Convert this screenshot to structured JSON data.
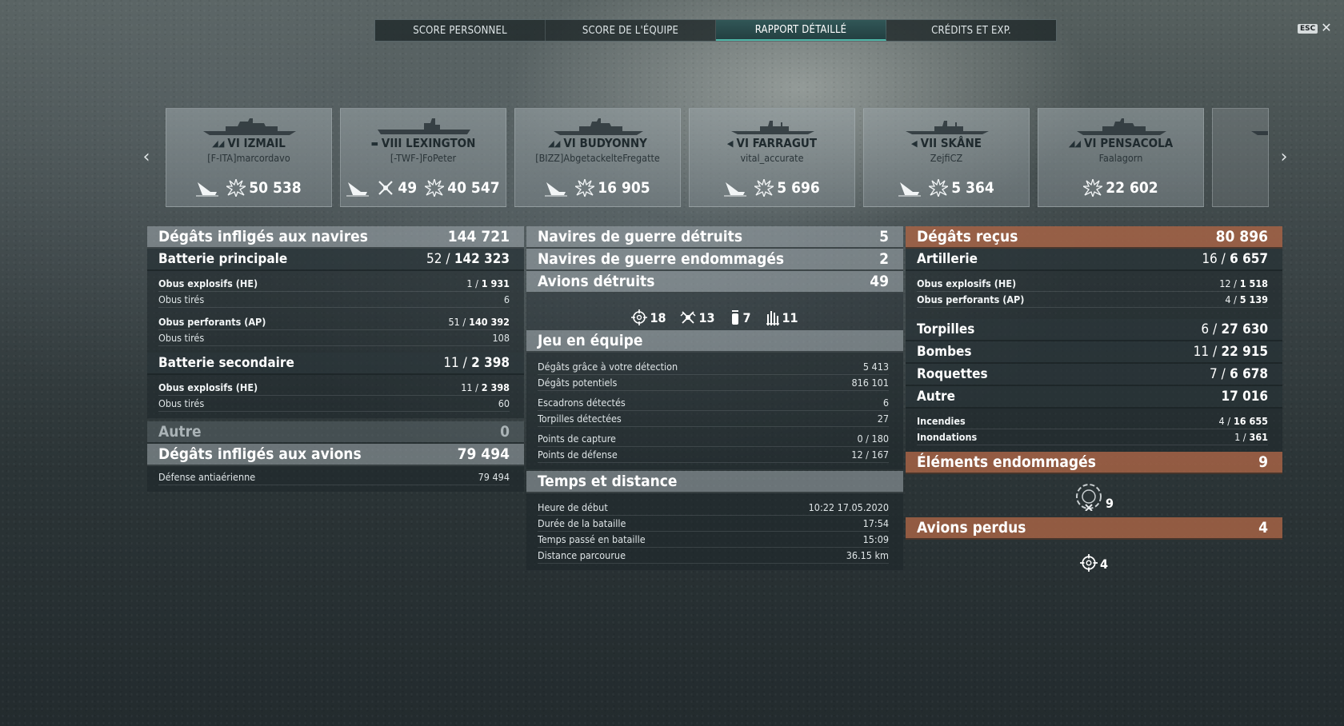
{
  "tabs": [
    {
      "label": "SCORE PERSONNEL"
    },
    {
      "label": "SCORE DE L'ÉQUIPE"
    },
    {
      "label": "RAPPORT DÉTAILLÉ",
      "active": true
    },
    {
      "label": "CRÉDITS ET EXP."
    }
  ],
  "esc": {
    "key": "ESC",
    "close": "✕"
  },
  "carousel": {
    "prev": "‹",
    "next": "›",
    "ships": [
      {
        "tier_name": "VI IZMAIL",
        "class_icon": "battleship-icon",
        "player": "[F-ITA]marcordavo",
        "planes": null,
        "damage": "50 538"
      },
      {
        "tier_name": "VIII LEXINGTON",
        "class_icon": "carrier-icon",
        "player": "[-TWF-]FoPeter",
        "planes": "49",
        "damage": "40 547"
      },
      {
        "tier_name": "VI BUDYONNY",
        "class_icon": "cruiser-icon",
        "player": "[BIZZ]AbgetackelteFregatte",
        "planes": null,
        "damage": "16 905"
      },
      {
        "tier_name": "VI FARRAGUT",
        "class_icon": "destroyer-icon",
        "player": "vital_accurate",
        "planes": null,
        "damage": "5 696"
      },
      {
        "tier_name": "VII SKÅNE",
        "class_icon": "destroyer-icon",
        "player": "ZejfiCZ",
        "planes": null,
        "damage": "5 364"
      },
      {
        "tier_name": "VI PENSACOLA",
        "class_icon": "cruiser-icon",
        "player": "Faalagorn",
        "planes": null,
        "damage": "22 602"
      }
    ]
  },
  "left": {
    "ships_damage": {
      "label": "Dégâts infligés aux navires",
      "value": "144 721"
    },
    "main_battery": {
      "label": "Batterie principale",
      "hits": "52 /",
      "value": "142 323"
    },
    "main_items": [
      {
        "label": "Obus explosifs (HE)",
        "hits": "1 /",
        "value": "1 931",
        "bold": true
      },
      {
        "label": "Obus tirés",
        "hits": "",
        "value": "6",
        "bold": false
      },
      {
        "label": "Obus perforants (AP)",
        "hits": "51 /",
        "value": "140 392",
        "bold": true
      },
      {
        "label": "Obus tirés",
        "hits": "",
        "value": "108",
        "bold": false
      }
    ],
    "secondary_battery": {
      "label": "Batterie secondaire",
      "hits": "11 /",
      "value": "2 398"
    },
    "secondary_items": [
      {
        "label": "Obus explosifs (HE)",
        "hits": "11 /",
        "value": "2 398",
        "bold": true
      },
      {
        "label": "Obus tirés",
        "hits": "",
        "value": "60",
        "bold": false
      }
    ],
    "other": {
      "label": "Autre",
      "value": "0"
    },
    "planes_damage": {
      "label": "Dégâts infligés aux avions",
      "value": "79 494"
    },
    "planes_items": [
      {
        "label": "Défense antiaérienne",
        "value": "79 494"
      }
    ]
  },
  "middle": {
    "ships_destroyed": {
      "label": "Navires de guerre détruits",
      "value": "5"
    },
    "ships_damaged": {
      "label": "Navires de guerre endommagés",
      "value": "2"
    },
    "planes_destroyed": {
      "label": "Avions détruits",
      "value": "49"
    },
    "plane_icons": [
      {
        "icon": "crosshair-icon",
        "value": "18"
      },
      {
        "icon": "fighter-icon",
        "value": "13"
      },
      {
        "icon": "consumable-icon",
        "value": "7"
      },
      {
        "icon": "aa-guns-icon",
        "value": "11"
      }
    ],
    "teamplay": {
      "label": "Jeu en équipe"
    },
    "teamplay_items": [
      {
        "label": "Dégâts grâce à votre détection",
        "value": "5 413"
      },
      {
        "label": "Dégâts potentiels",
        "value": "816 101"
      },
      {
        "label": "Escadrons détectés",
        "value": "6"
      },
      {
        "label": "Torpilles détectées",
        "value": "27"
      },
      {
        "label": "Points de capture",
        "value": "0 / 180"
      },
      {
        "label": "Points de défense",
        "value": "12 / 167"
      }
    ],
    "time": {
      "label": "Temps et distance"
    },
    "time_items": [
      {
        "label": "Heure de début",
        "value": "10:22  17.05.2020"
      },
      {
        "label": "Durée de la bataille",
        "value": "17:54"
      },
      {
        "label": "Temps passé en bataille",
        "value": "15:09"
      },
      {
        "label": "Distance parcourue",
        "value": "36.15 km"
      }
    ]
  },
  "right": {
    "received": {
      "label": "Dégâts reçus",
      "value": "80 896"
    },
    "artillery": {
      "label": "Artillerie",
      "hits": "16 /",
      "value": "6 657"
    },
    "artillery_items": [
      {
        "label": "Obus explosifs (HE)",
        "hits": "12 /",
        "value": "1 518"
      },
      {
        "label": "Obus perforants (AP)",
        "hits": "4 /",
        "value": "5 139"
      }
    ],
    "torpedoes": {
      "label": "Torpilles",
      "hits": "6 /",
      "value": "27 630"
    },
    "bombs": {
      "label": "Bombes",
      "hits": "11 /",
      "value": "22 915"
    },
    "rockets": {
      "label": "Roquettes",
      "hits": "7 /",
      "value": "6 678"
    },
    "other": {
      "label": "Autre",
      "value": "17 016"
    },
    "other_items": [
      {
        "label": "Incendies",
        "hits": "4 /",
        "value": "16 655"
      },
      {
        "label": "Inondations",
        "hits": "1 /",
        "value": "361"
      }
    ],
    "modules": {
      "label": "Éléments endommagés",
      "value": "9"
    },
    "modules_icon": {
      "icon": "damaged-module-icon",
      "value": "9"
    },
    "planes_lost": {
      "label": "Avions perdus",
      "value": "4"
    },
    "planes_lost_icon": {
      "icon": "crosshair-icon",
      "value": "4"
    }
  },
  "colors": {
    "accent": "#4fb7a8",
    "received_header": "#aa6446",
    "header_grey": "#a0aaae"
  }
}
